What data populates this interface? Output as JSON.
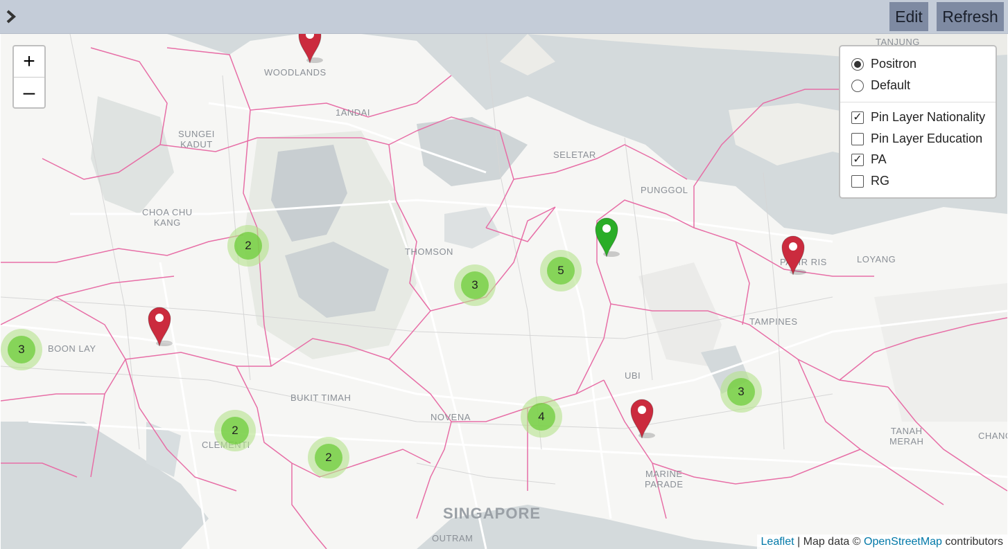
{
  "toolbar": {
    "edit_label": "Edit",
    "refresh_label": "Refresh",
    "toggle_icon": "chevron-right-icon"
  },
  "zoom": {
    "in_label": "+",
    "out_label": "–"
  },
  "layers": {
    "base": [
      {
        "label": "Positron",
        "selected": true
      },
      {
        "label": "Default",
        "selected": false
      }
    ],
    "overlays": [
      {
        "label": "Pin Layer Nationality",
        "checked": true
      },
      {
        "label": "Pin Layer Education",
        "checked": false
      },
      {
        "label": "PA",
        "checked": true
      },
      {
        "label": "RG",
        "checked": false
      }
    ],
    "check_glyph": "✓"
  },
  "map_labels": {
    "woodlands": "WOODLANDS",
    "mandai": "1ANDAI",
    "sungei_kadut": "SUNGEI\nKADUT",
    "choa_chu_kang": "CHOA CHU\nKANG",
    "seletar": "SELETAR",
    "punggol": "PUNGGOL",
    "thomson": "THOMSON",
    "boon_lay": "BOON LAY",
    "bukit_timah": "BUKIT TIMAH",
    "novena": "NOVENA",
    "clementi": "CLEMENTI",
    "tampines": "TAMPINES",
    "loyang": "LOYANG",
    "pasir_ris": "PASIR RIS",
    "tanah_merah": "TANAH\nMERAH",
    "changi": "CHANG",
    "marine_parade": "MARINE\nPARADE",
    "ubi": "UBI",
    "singapore": "SINGAPORE",
    "outram": "OUTRAM",
    "tanjung": "TANJUNG"
  },
  "clusters": [
    "2",
    "3",
    "5",
    "3",
    "2",
    "2",
    "4",
    "3"
  ],
  "pin_colors": {
    "red": "#cb2b3e",
    "green": "#2aad27"
  },
  "attribution": {
    "leaflet": "Leaflet",
    "separator": " | Map data © ",
    "osm": "OpenStreetMap",
    "suffix": " contributors"
  }
}
